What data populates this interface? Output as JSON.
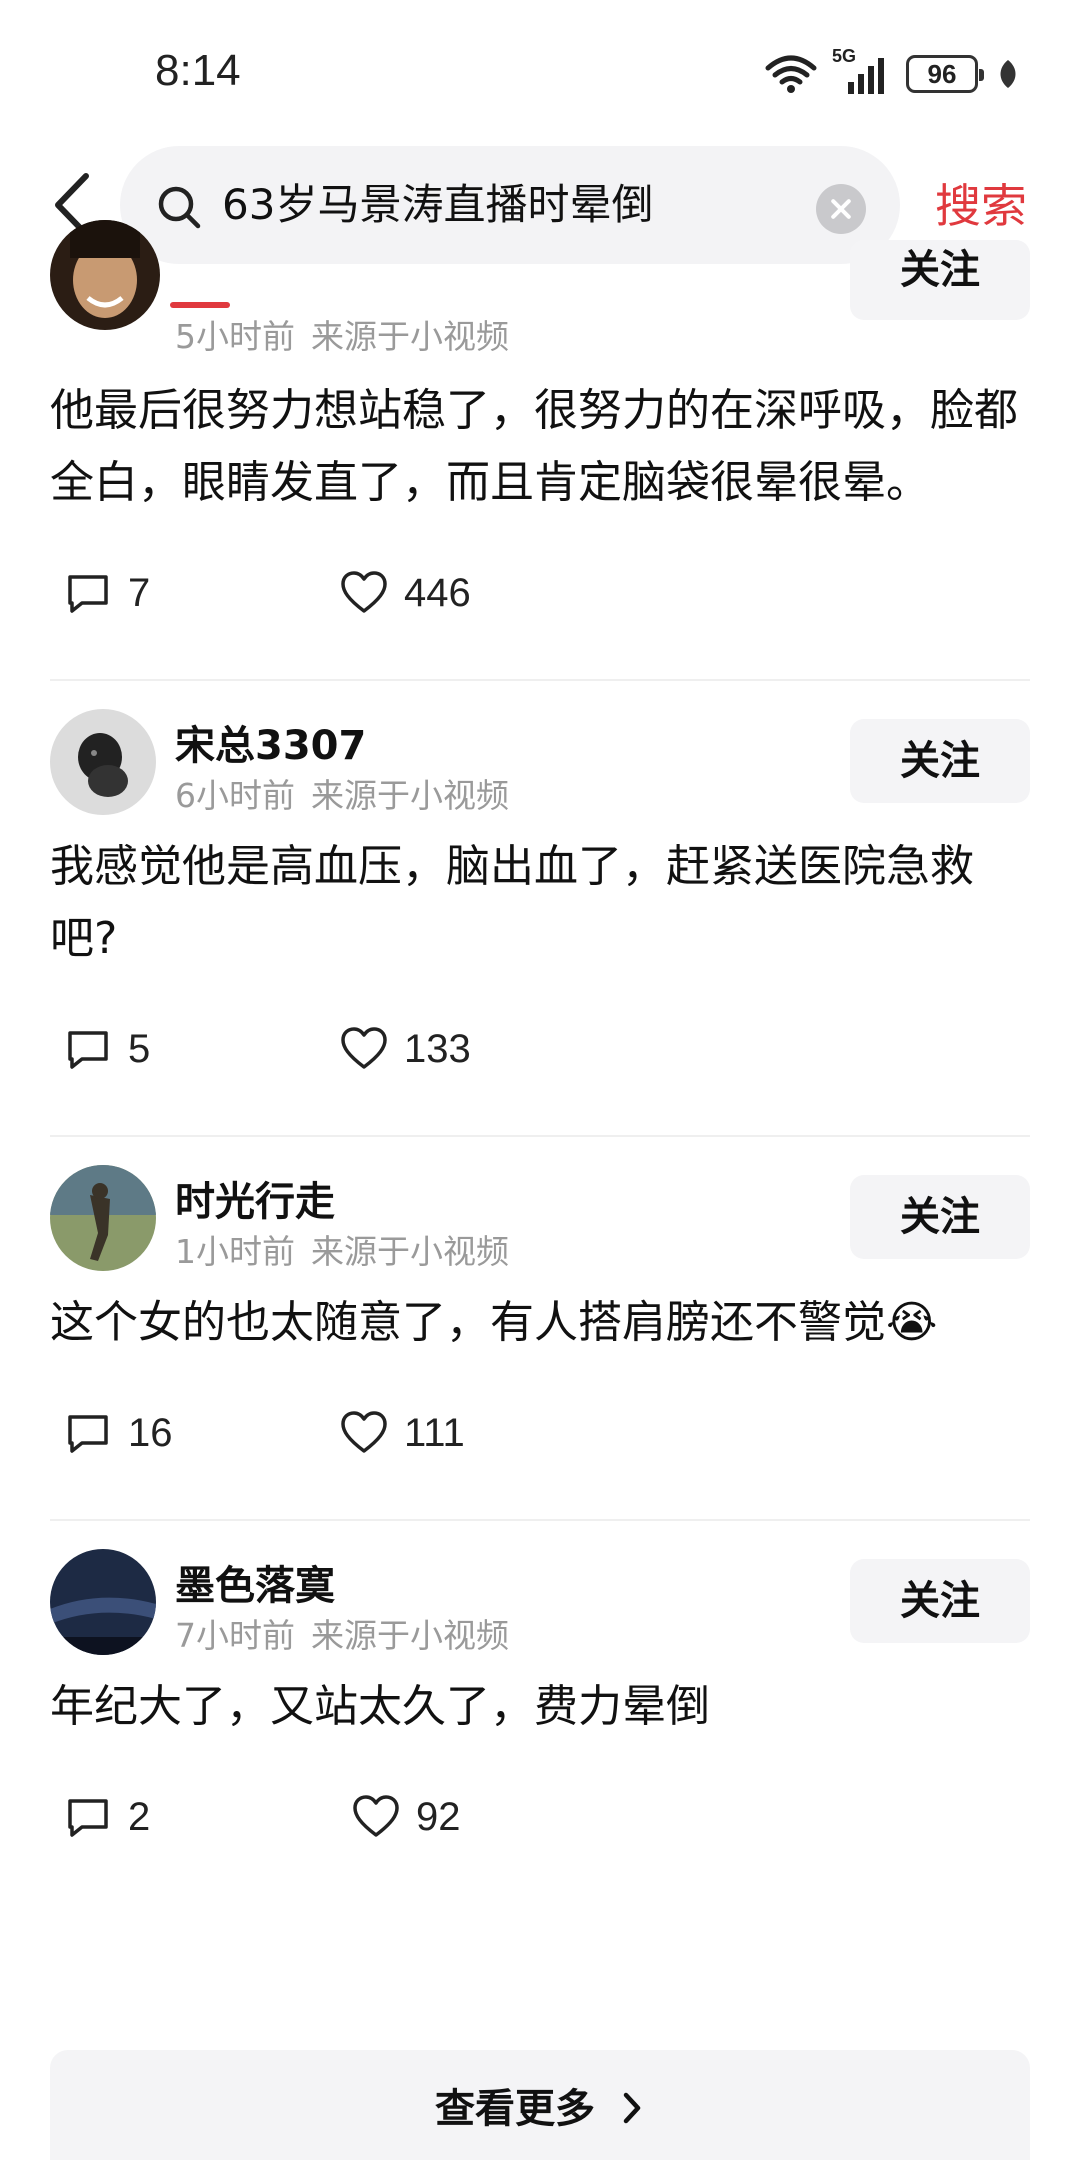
{
  "status_bar": {
    "time": "8:14",
    "network": "5G",
    "battery": "96",
    "icons": [
      "wifi-icon",
      "signal-icon",
      "battery-icon",
      "leaf-icon"
    ]
  },
  "search": {
    "query": "63岁马景涛直播时晕倒",
    "submit_label": "搜索",
    "icons": [
      "back-arrow-icon",
      "search-icon",
      "clear-icon"
    ]
  },
  "comments": [
    {
      "user": "",
      "time": "5小时前",
      "source": "来源于小视频",
      "follow_label": "关注",
      "text": "他最后很努力想站稳了，很努力的在深呼吸，脸都全白，眼睛发直了，而且肯定脑袋很晕很晕。",
      "replies": "7",
      "likes": "446"
    },
    {
      "user": "宋总3307",
      "time": "6小时前",
      "source": "来源于小视频",
      "follow_label": "关注",
      "text": "我感觉他是高血压，脑出血了，赶紧送医院急救吧?",
      "replies": "5",
      "likes": "133"
    },
    {
      "user": "时光行走",
      "time": "1小时前",
      "source": "来源于小视频",
      "follow_label": "关注",
      "text": "这个女的也太随意了，有人搭肩膀还不警觉😭",
      "replies": "16",
      "likes": "111"
    },
    {
      "user": "墨色落寞",
      "time": "7小时前",
      "source": "来源于小视频",
      "follow_label": "关注",
      "text": "年纪大了，又站太久了，费力晕倒",
      "replies": "2",
      "likes": "92"
    }
  ],
  "show_more_label": "查看更多",
  "colors": {
    "accent": "#e0393e",
    "muted_text": "#9a9a9a",
    "button_bg": "#f4f4f6"
  }
}
